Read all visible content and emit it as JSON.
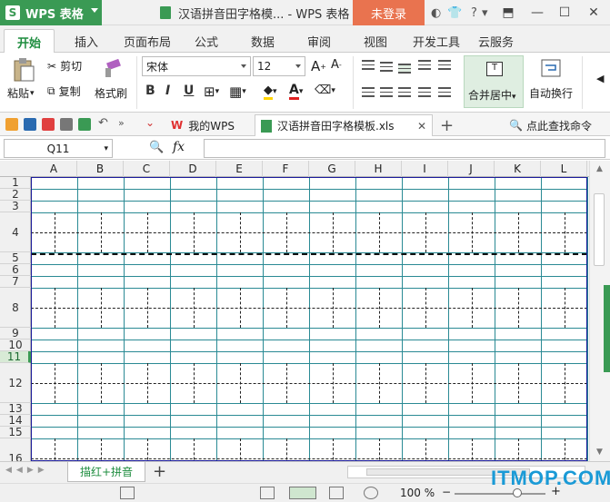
{
  "app": {
    "name": "WPS 表格",
    "doc_title": "汉语拼音田字格模... - WPS 表格",
    "login_label": "未登录",
    "colors": {
      "brand": "#3a9a54",
      "login": "#e9734f",
      "grid": "#2a8a94",
      "border": "#1a1a9a"
    }
  },
  "ribbon_tabs": [
    "开始",
    "插入",
    "页面布局",
    "公式",
    "数据",
    "审阅",
    "视图",
    "开发工具",
    "云服务"
  ],
  "ribbon": {
    "paste": "粘贴",
    "cut": "剪切",
    "copy": "复制",
    "format_painter": "格式刷",
    "font_name": "宋体",
    "font_size": "12",
    "bold": "B",
    "italic": "I",
    "underline": "U",
    "merge_center": "合并居中",
    "wrap_text": "自动换行"
  },
  "doc_tabs": {
    "my_wps": "我的WPS",
    "file": "汉语拼音田字格模板.xls",
    "search": "点此查找命令"
  },
  "formula_bar": {
    "name_box": "Q11",
    "fx": "fx",
    "value": ""
  },
  "columns": [
    "A",
    "B",
    "C",
    "D",
    "E",
    "F",
    "G",
    "H",
    "I",
    "J",
    "K",
    "L"
  ],
  "rows": [
    "1",
    "2",
    "3",
    "4",
    "5",
    "6",
    "7",
    "8",
    "9",
    "10",
    "11",
    "12",
    "13",
    "14",
    "15",
    "16"
  ],
  "selected_row": "11",
  "sheet_tabs": {
    "active": "描红+拼音",
    "add": "+"
  },
  "status": {
    "zoom": "100 %"
  },
  "watermark": "ITMOP.COM"
}
